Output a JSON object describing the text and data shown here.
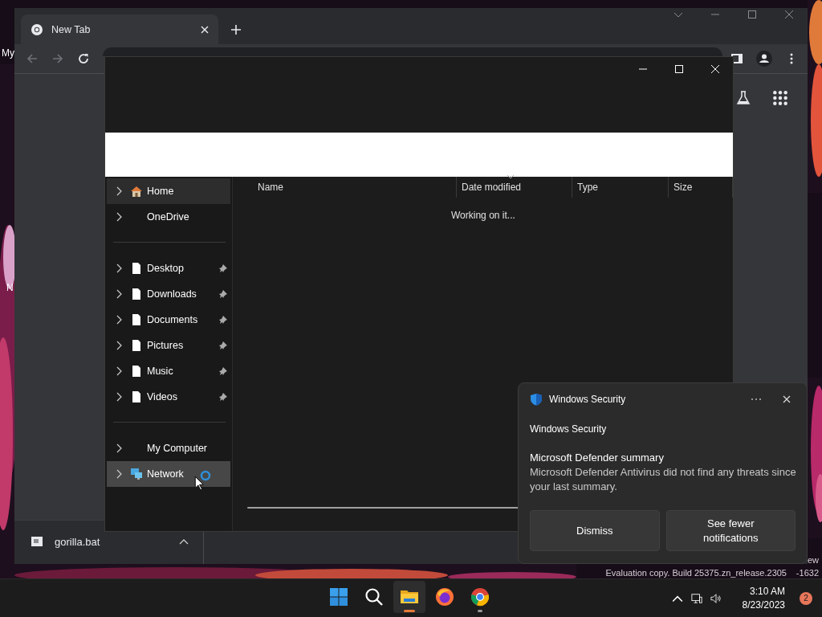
{
  "desktop": {
    "icon_labels": [
      {
        "label": "My"
      },
      {
        "label": "N"
      }
    ],
    "watermark_lines": [
      "ew",
      "Evaluation copy. Build 25375.zn_release.2305",
      "-1632"
    ]
  },
  "browser": {
    "tabs": [
      {
        "title": "New Tab",
        "selected": true
      }
    ],
    "download": {
      "file": "gorilla.bat"
    }
  },
  "explorer": {
    "nav_groups": [
      [
        {
          "label": "Home",
          "kind": "home",
          "selected": true,
          "hovered": false,
          "pinned": false,
          "busy": false
        },
        {
          "label": "OneDrive",
          "kind": "plain",
          "selected": false,
          "hovered": false,
          "pinned": false,
          "busy": false
        }
      ],
      [
        {
          "label": "Desktop",
          "kind": "file",
          "selected": false,
          "hovered": false,
          "pinned": true,
          "busy": false
        },
        {
          "label": "Downloads",
          "kind": "file",
          "selected": false,
          "hovered": false,
          "pinned": true,
          "busy": false
        },
        {
          "label": "Documents",
          "kind": "file",
          "selected": false,
          "hovered": false,
          "pinned": true,
          "busy": false
        },
        {
          "label": "Pictures",
          "kind": "file",
          "selected": false,
          "hovered": false,
          "pinned": true,
          "busy": false
        },
        {
          "label": "Music",
          "kind": "file",
          "selected": false,
          "hovered": false,
          "pinned": true,
          "busy": false
        },
        {
          "label": "Videos",
          "kind": "file",
          "selected": false,
          "hovered": false,
          "pinned": true,
          "busy": false
        }
      ],
      [
        {
          "label": "My Computer",
          "kind": "plain",
          "selected": false,
          "hovered": false,
          "pinned": false,
          "busy": false
        },
        {
          "label": "Network",
          "kind": "network",
          "selected": false,
          "hovered": true,
          "pinned": false,
          "busy": true
        }
      ]
    ],
    "columns": [
      {
        "label": "Name",
        "sorted": false
      },
      {
        "label": "Date modified",
        "sorted": true
      },
      {
        "label": "Type",
        "sorted": false
      },
      {
        "label": "Size",
        "sorted": false
      }
    ],
    "status": "Working on it..."
  },
  "toast": {
    "app": "Windows Security",
    "source": "Windows Security",
    "title": "Microsoft Defender summary",
    "body": "Microsoft Defender Antivirus did not find any threats since your last summary.",
    "buttons": [
      "Dismiss",
      "See fewer notifications"
    ]
  },
  "taskbar": {
    "apps": [
      {
        "kind": "start",
        "active": false,
        "running": false
      },
      {
        "kind": "search",
        "active": false,
        "running": false
      },
      {
        "kind": "explorer",
        "active": true,
        "running": true
      },
      {
        "kind": "firefox",
        "active": false,
        "running": false
      },
      {
        "kind": "chrome",
        "active": false,
        "running": true
      }
    ],
    "time": "3:10 AM",
    "date": "8/23/2023",
    "badge": "2"
  }
}
